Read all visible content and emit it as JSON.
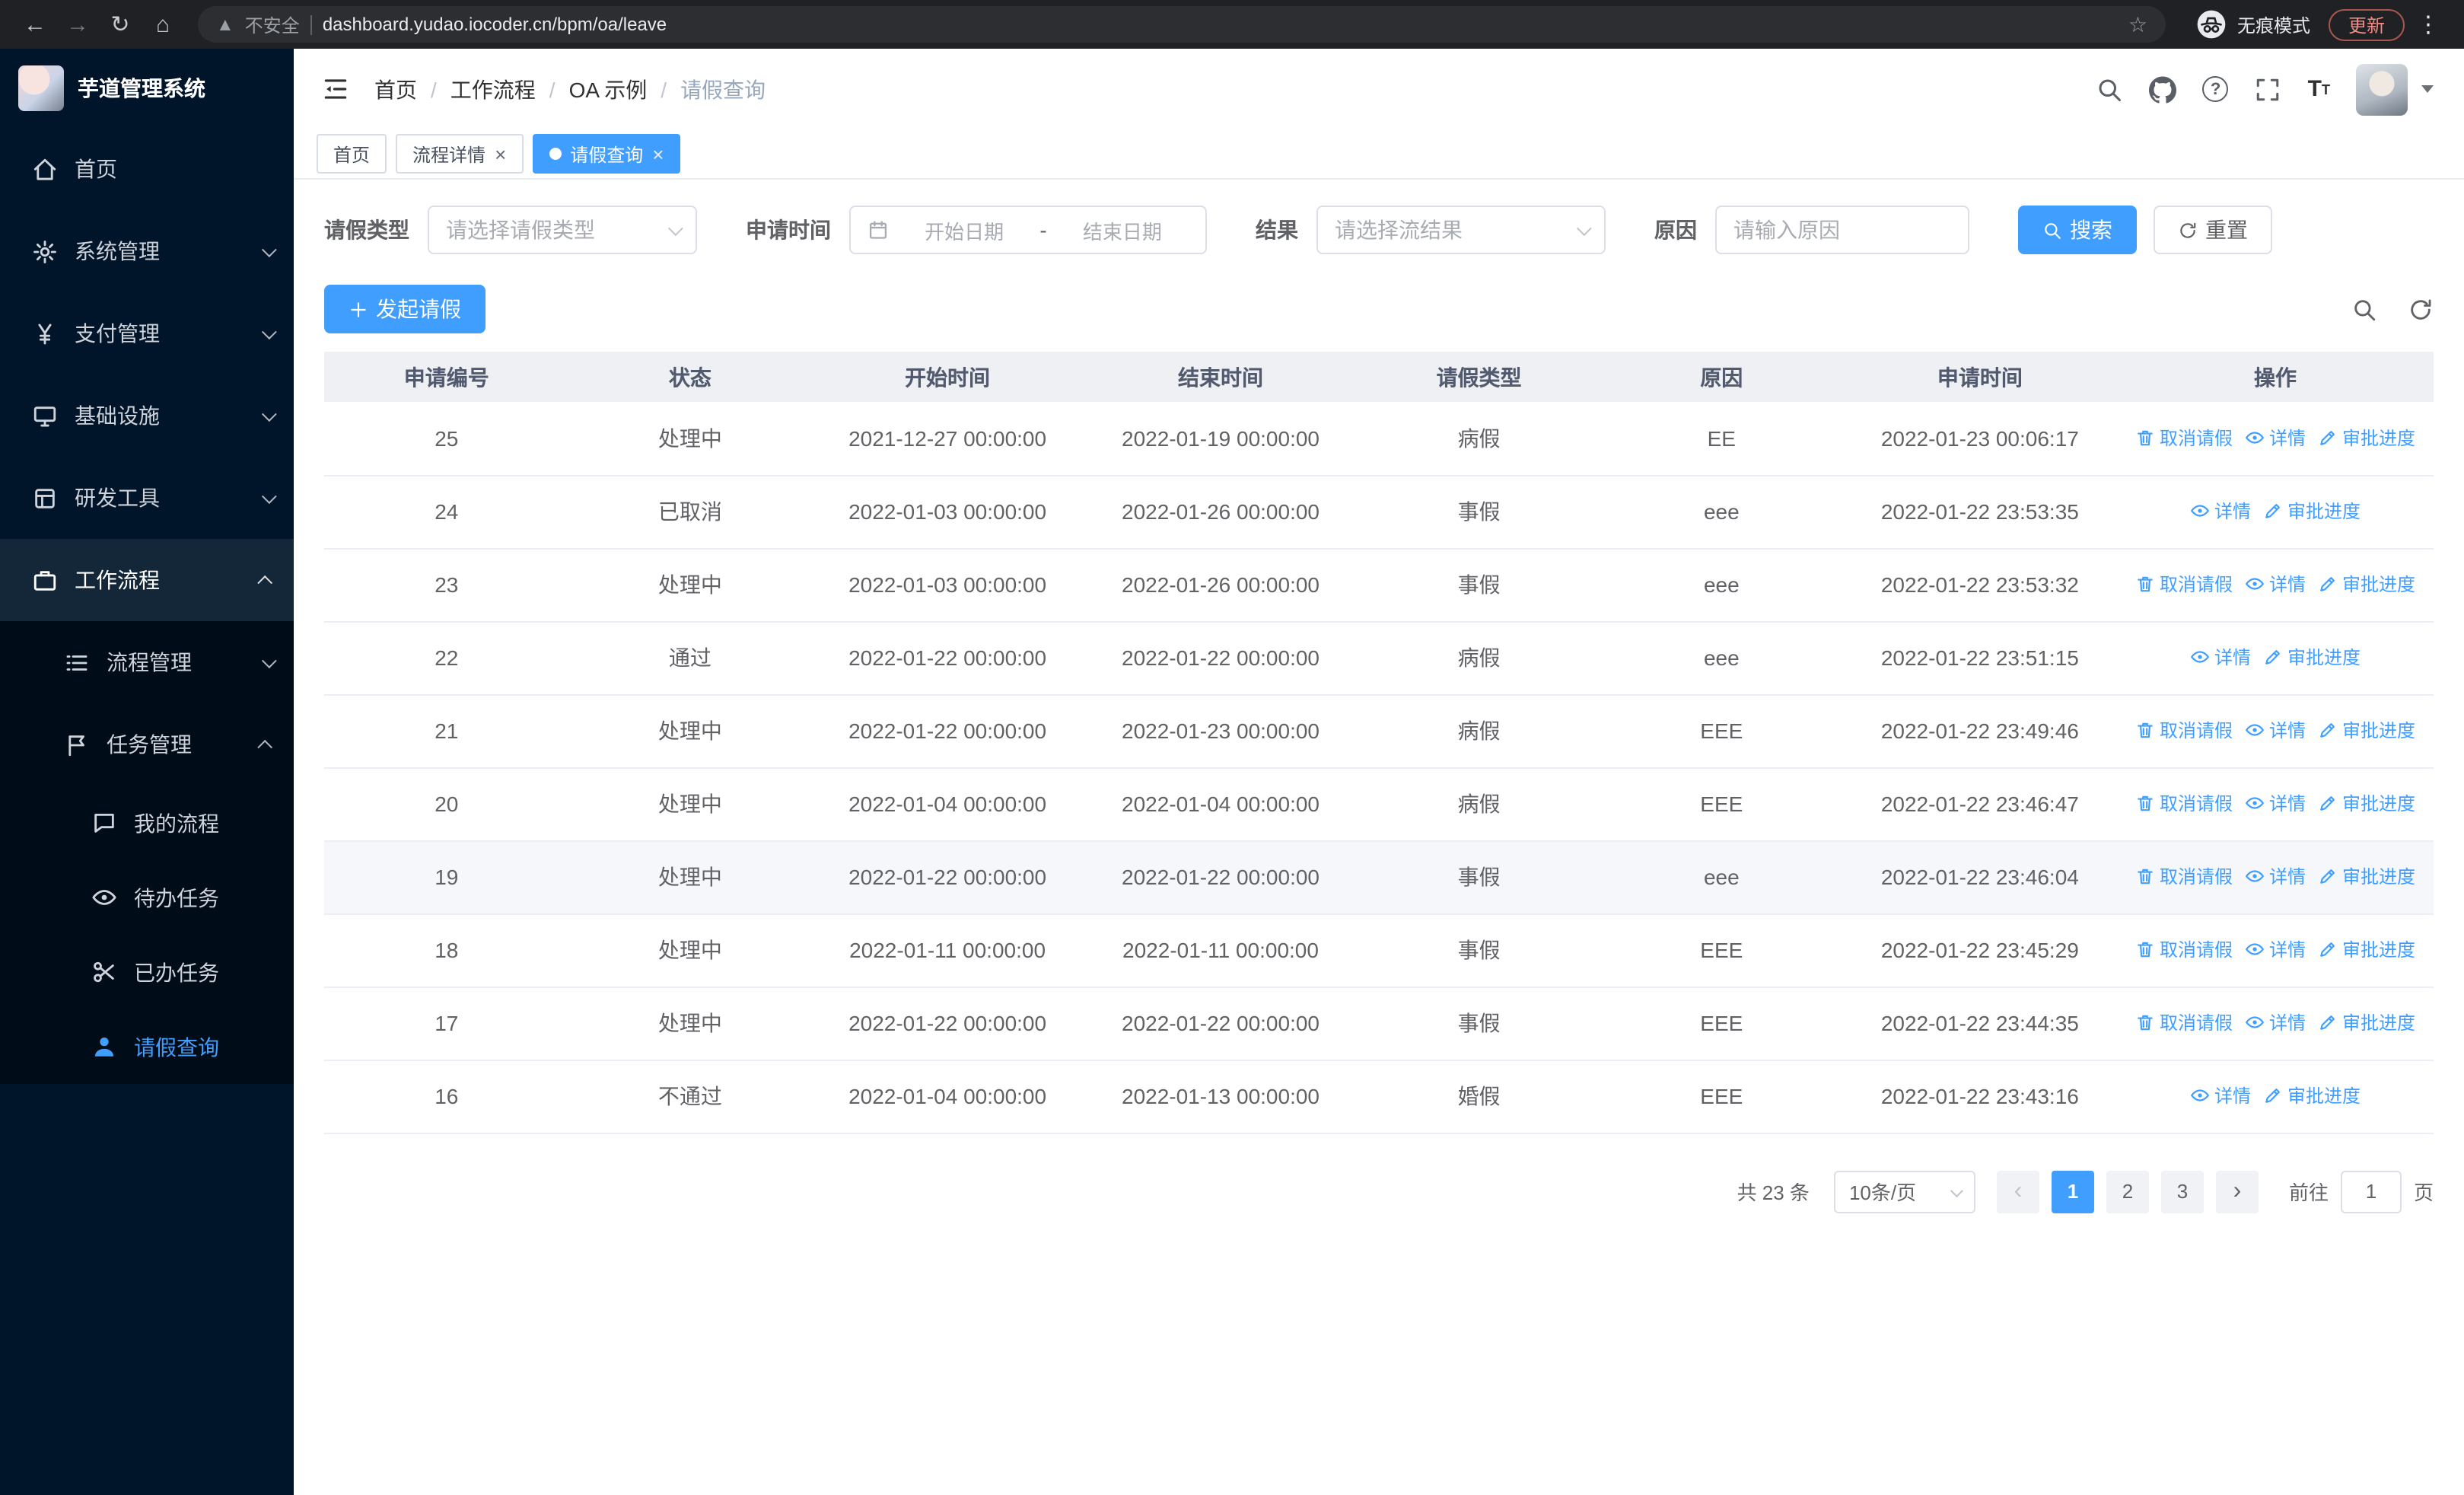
{
  "colors": {
    "accent": "#409eff",
    "sidebar_bg": "#001529",
    "sidebar_submenu_bg": "#000c17",
    "table_header_bg": "#eef0f4",
    "row_hover_bg": "#f5f7fa"
  },
  "browser": {
    "security_warning": "不安全",
    "url": "dashboard.yudao.iocoder.cn/bpm/oa/leave",
    "incognito_label": "无痕模式",
    "update_label": "更新"
  },
  "sidebar": {
    "logo_title": "芋道管理系统",
    "items": [
      {
        "label": "首页",
        "icon": "home-icon",
        "expandable": false
      },
      {
        "label": "系统管理",
        "icon": "gear-icon",
        "expandable": true,
        "expanded": false
      },
      {
        "label": "支付管理",
        "icon": "payment-icon",
        "expandable": true,
        "expanded": false
      },
      {
        "label": "基础设施",
        "icon": "infrastructure-icon",
        "expandable": true,
        "expanded": false
      },
      {
        "label": "研发工具",
        "icon": "devtools-icon",
        "expandable": true,
        "expanded": false
      },
      {
        "label": "工作流程",
        "icon": "workflow-icon",
        "expandable": true,
        "expanded": true
      }
    ],
    "submenu": [
      {
        "label": "流程管理",
        "icon": "process-list-icon",
        "expandable": true,
        "expanded": false
      },
      {
        "label": "任务管理",
        "icon": "task-flag-icon",
        "expandable": true,
        "expanded": true
      }
    ],
    "task_items": [
      {
        "label": "我的流程",
        "icon": "chat-icon",
        "active": false
      },
      {
        "label": "待办任务",
        "icon": "eye-icon",
        "active": false
      },
      {
        "label": "已办任务",
        "icon": "done-icon",
        "active": false
      },
      {
        "label": "请假查询",
        "icon": "user-icon",
        "active": true
      }
    ]
  },
  "header": {
    "breadcrumb": [
      "首页",
      "工作流程",
      "OA 示例",
      "请假查询"
    ],
    "right_icons": [
      "search-icon",
      "github-icon",
      "question-icon",
      "fullscreen-icon",
      "font-size-icon",
      "user-avatar",
      "chevron-down-icon"
    ]
  },
  "tabs": [
    {
      "label": "首页",
      "closable": false,
      "active": false
    },
    {
      "label": "流程详情",
      "closable": true,
      "active": false
    },
    {
      "label": "请假查询",
      "closable": true,
      "active": true
    }
  ],
  "filters": {
    "leave_type_label": "请假类型",
    "leave_type_placeholder": "请选择请假类型",
    "apply_time_label": "申请时间",
    "start_date_placeholder": "开始日期",
    "range_separator": "-",
    "end_date_placeholder": "结束日期",
    "result_label": "结果",
    "result_placeholder": "请选择流结果",
    "reason_label": "原因",
    "reason_placeholder": "请输入原因",
    "search_button": "搜索",
    "reset_button": "重置"
  },
  "toolbar": {
    "create_button": "发起请假"
  },
  "table": {
    "columns": [
      "申请编号",
      "状态",
      "开始时间",
      "结束时间",
      "请假类型",
      "原因",
      "申请时间",
      "操作"
    ],
    "action_labels": {
      "cancel": "取消请假",
      "detail": "详情",
      "progress": "审批进度"
    },
    "action_icons": {
      "cancel": "trash-icon",
      "detail": "eye-icon",
      "progress": "edit-icon"
    },
    "rows": [
      {
        "id": "25",
        "status": "处理中",
        "start": "2021-12-27 00:00:00",
        "end": "2022-01-19 00:00:00",
        "type": "病假",
        "reason": "EE",
        "apply_time": "2022-01-23 00:06:17",
        "actions": [
          "cancel",
          "detail",
          "progress"
        ],
        "highlight": false
      },
      {
        "id": "24",
        "status": "已取消",
        "start": "2022-01-03 00:00:00",
        "end": "2022-01-26 00:00:00",
        "type": "事假",
        "reason": "eee",
        "apply_time": "2022-01-22 23:53:35",
        "actions": [
          "detail",
          "progress"
        ],
        "highlight": false
      },
      {
        "id": "23",
        "status": "处理中",
        "start": "2022-01-03 00:00:00",
        "end": "2022-01-26 00:00:00",
        "type": "事假",
        "reason": "eee",
        "apply_time": "2022-01-22 23:53:32",
        "actions": [
          "cancel",
          "detail",
          "progress"
        ],
        "highlight": false
      },
      {
        "id": "22",
        "status": "通过",
        "start": "2022-01-22 00:00:00",
        "end": "2022-01-22 00:00:00",
        "type": "病假",
        "reason": "eee",
        "apply_time": "2022-01-22 23:51:15",
        "actions": [
          "detail",
          "progress"
        ],
        "highlight": false
      },
      {
        "id": "21",
        "status": "处理中",
        "start": "2022-01-22 00:00:00",
        "end": "2022-01-23 00:00:00",
        "type": "病假",
        "reason": "EEE",
        "apply_time": "2022-01-22 23:49:46",
        "actions": [
          "cancel",
          "detail",
          "progress"
        ],
        "highlight": false
      },
      {
        "id": "20",
        "status": "处理中",
        "start": "2022-01-04 00:00:00",
        "end": "2022-01-04 00:00:00",
        "type": "病假",
        "reason": "EEE",
        "apply_time": "2022-01-22 23:46:47",
        "actions": [
          "cancel",
          "detail",
          "progress"
        ],
        "highlight": false
      },
      {
        "id": "19",
        "status": "处理中",
        "start": "2022-01-22 00:00:00",
        "end": "2022-01-22 00:00:00",
        "type": "事假",
        "reason": "eee",
        "apply_time": "2022-01-22 23:46:04",
        "actions": [
          "cancel",
          "detail",
          "progress"
        ],
        "highlight": true
      },
      {
        "id": "18",
        "status": "处理中",
        "start": "2022-01-11 00:00:00",
        "end": "2022-01-11 00:00:00",
        "type": "事假",
        "reason": "EEE",
        "apply_time": "2022-01-22 23:45:29",
        "actions": [
          "cancel",
          "detail",
          "progress"
        ],
        "highlight": false
      },
      {
        "id": "17",
        "status": "处理中",
        "start": "2022-01-22 00:00:00",
        "end": "2022-01-22 00:00:00",
        "type": "事假",
        "reason": "EEE",
        "apply_time": "2022-01-22 23:44:35",
        "actions": [
          "cancel",
          "detail",
          "progress"
        ],
        "highlight": false
      },
      {
        "id": "16",
        "status": "不通过",
        "start": "2022-01-04 00:00:00",
        "end": "2022-01-13 00:00:00",
        "type": "婚假",
        "reason": "EEE",
        "apply_time": "2022-01-22 23:43:16",
        "actions": [
          "detail",
          "progress"
        ],
        "highlight": false
      }
    ]
  },
  "pagination": {
    "total_text": "共 23 条",
    "page_size_value": "10条/页",
    "pages": [
      "1",
      "2",
      "3"
    ],
    "active_page": "1",
    "goto_prefix": "前往",
    "goto_value": "1",
    "goto_suffix": "页"
  }
}
